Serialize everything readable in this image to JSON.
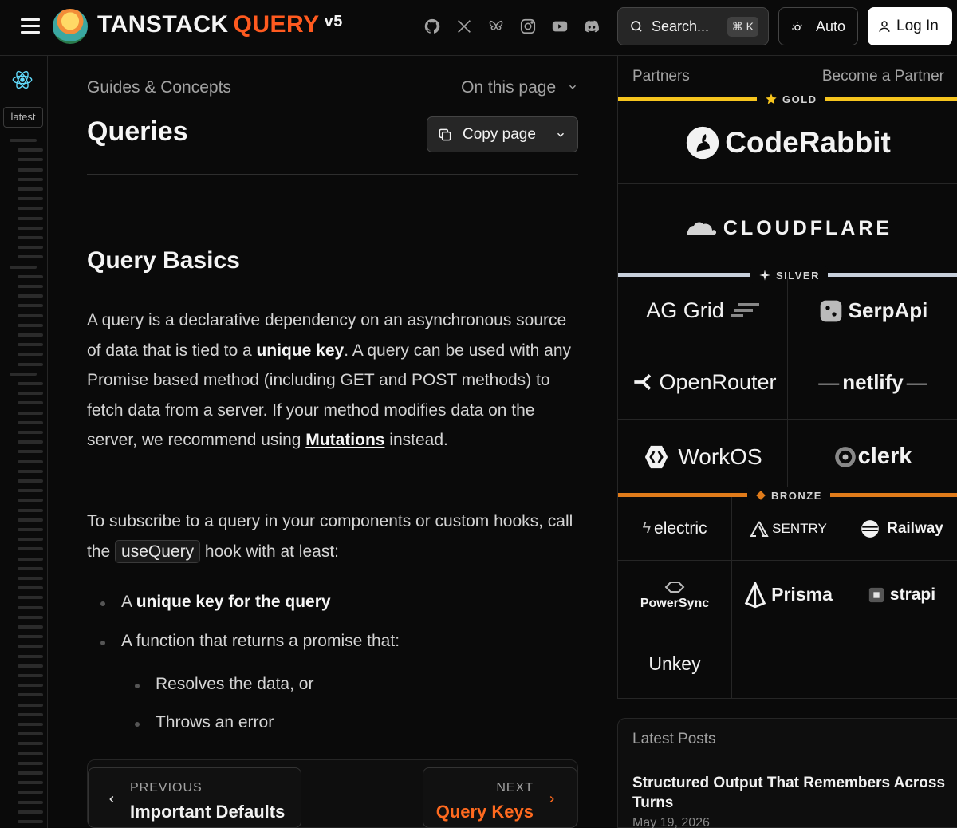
{
  "header": {
    "brand_main": "TANSTACK",
    "brand_accent": "QUERY",
    "version": "v5",
    "search_label": "Search...",
    "search_shortcut": "⌘ K",
    "theme_label": "Auto",
    "login_label": "Log In",
    "social_icons": [
      "github-icon",
      "x-icon",
      "bluesky-icon",
      "instagram-icon",
      "youtube-icon",
      "discord-icon"
    ]
  },
  "rail": {
    "version_badge": "latest"
  },
  "main": {
    "breadcrumb": "Guides & Concepts",
    "on_this_page": "On this page",
    "title": "Queries",
    "copy_label": "Copy page",
    "section_heading": "Query Basics",
    "p1": {
      "a": "A query is a declarative dependency on an asynchronous source of data that is tied to a ",
      "b": "unique key",
      "c": ". A query can be used with any Promise based method (including GET and POST methods) to fetch data from a server. If your method modifies data on the server, we recommend using ",
      "link": "Mutations",
      "d": " instead."
    },
    "p2": {
      "a": "To subscribe to a query in your components or custom hooks, call the ",
      "code": "useQuery",
      "b": " hook with at least:"
    },
    "bullets": {
      "b1_prefix": "A ",
      "b1_bold": "unique key for the query",
      "b2": "A function that returns a promise that:",
      "b2a": "Resolves the data, or",
      "b2b": "Throws an error"
    },
    "prev": {
      "small": "PREVIOUS",
      "title": "Important Defaults"
    },
    "next": {
      "small": "NEXT",
      "title": "Query Keys"
    }
  },
  "partners": {
    "heading": "Partners",
    "become": "Become a Partner",
    "gold_label": "GOLD",
    "silver_label": "SILVER",
    "bronze_label": "BRONZE",
    "gold": [
      "CodeRabbit",
      "CLOUDFLARE"
    ],
    "silver": [
      "AG Grid",
      "SerpApi",
      "OpenRouter",
      "netlify",
      "WorkOS",
      "clerk"
    ],
    "bronze": [
      "electric",
      "SENTRY",
      "Railway",
      "PowerSync",
      "Prisma",
      "strapi",
      "Unkey"
    ]
  },
  "posts": {
    "heading": "Latest Posts",
    "title": "Structured Output That Remembers Across Turns",
    "date": "May 19, 2026"
  },
  "colors": {
    "accent": "#ff5a1f",
    "gold": "#f7c51e",
    "silver": "#c8d0dc",
    "bronze": "#e07b1a"
  }
}
